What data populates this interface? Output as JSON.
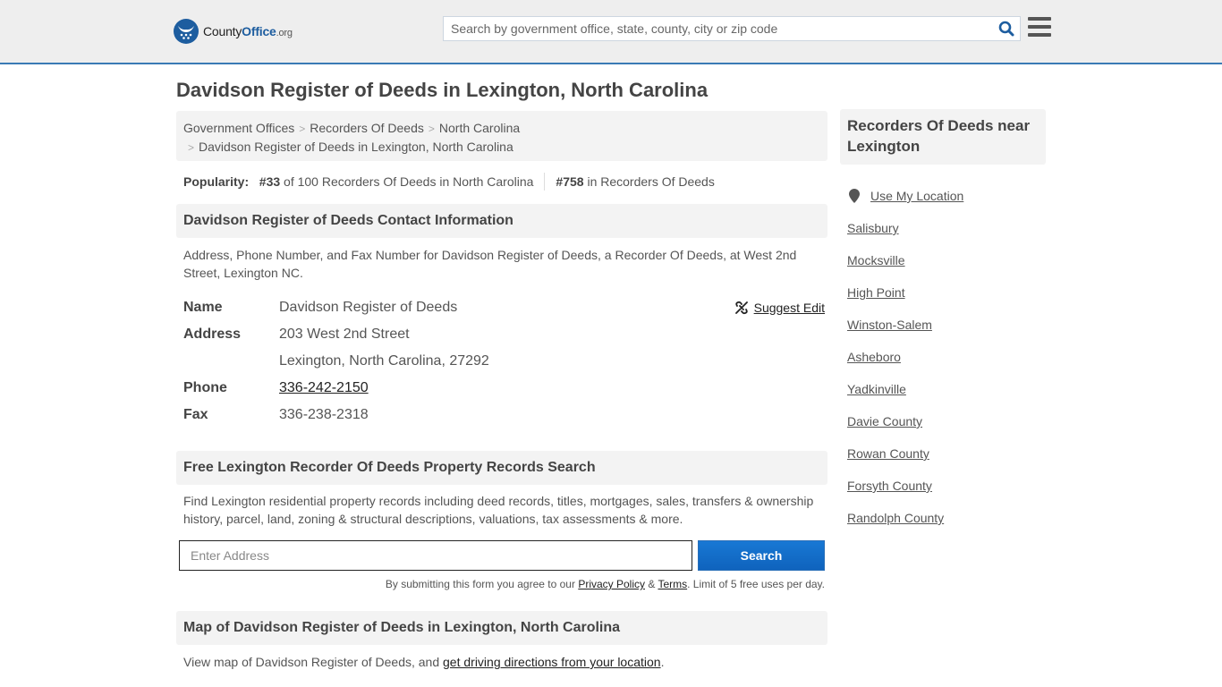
{
  "header": {
    "logo": {
      "name_plain": "County",
      "name_bold": "Office",
      "tld": ".org"
    },
    "search_placeholder": "Search by government office, state, county, city or zip code",
    "brand_color": "#1d5d9f",
    "accent_border": "#3a7ab5"
  },
  "page_title": "Davidson Register of Deeds in Lexington, North Carolina",
  "breadcrumb": {
    "items": [
      "Government Offices",
      "Recorders Of Deeds",
      "North Carolina"
    ],
    "current": "Davidson Register of Deeds in Lexington, North Carolina"
  },
  "popularity": {
    "label": "Popularity:",
    "state_rank": "#33",
    "state_text": "of 100 Recorders Of Deeds in North Carolina",
    "national_rank": "#758",
    "national_text": "in Recorders Of Deeds"
  },
  "contact": {
    "heading": "Davidson Register of Deeds Contact Information",
    "description": "Address, Phone Number, and Fax Number for Davidson Register of Deeds, a Recorder Of Deeds, at West 2nd Street, Lexington NC.",
    "suggest_edit": "Suggest Edit",
    "rows": {
      "name_label": "Name",
      "name_value": "Davidson Register of Deeds",
      "address_label": "Address",
      "address_line1": "203 West 2nd Street",
      "address_line2": "Lexington, North Carolina, 27292",
      "phone_label": "Phone",
      "phone_value": "336-242-2150",
      "fax_label": "Fax",
      "fax_value": "336-238-2318"
    }
  },
  "property_search": {
    "heading": "Free Lexington Recorder Of Deeds Property Records Search",
    "description": "Find Lexington residential property records including deed records, titles, mortgages, sales, transfers & ownership history, parcel, land, zoning & structural descriptions, valuations, tax assessments & more.",
    "input_placeholder": "Enter Address",
    "button_label": "Search",
    "disclaimer_prefix": "By submitting this form you agree to our ",
    "privacy_link": "Privacy Policy",
    "amp": " & ",
    "terms_link": "Terms",
    "disclaimer_suffix": ". Limit of 5 free uses per day."
  },
  "map_section": {
    "heading": "Map of Davidson Register of Deeds in Lexington, North Carolina",
    "text_prefix": "View map of Davidson Register of Deeds, and ",
    "directions_link": "get driving directions from your location",
    "text_suffix": "."
  },
  "sidebar": {
    "heading": "Recorders Of Deeds near Lexington",
    "use_location": "Use My Location",
    "items": [
      "Salisbury",
      "Mocksville",
      "High Point",
      "Winston-Salem",
      "Asheboro",
      "Yadkinville",
      "Davie County",
      "Rowan County",
      "Forsyth County",
      "Randolph County"
    ]
  }
}
